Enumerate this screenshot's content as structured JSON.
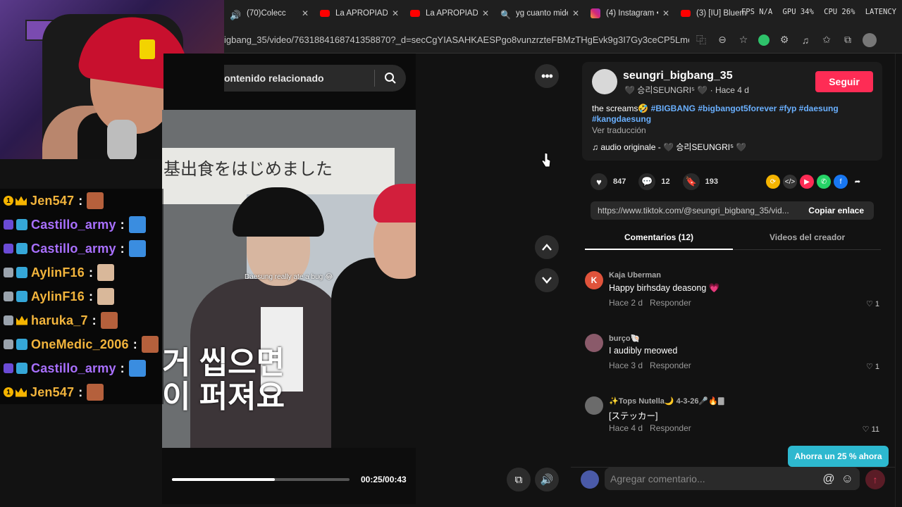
{
  "browser": {
    "tabs": [
      {
        "title": "(70)Colecc",
        "icon": "speaker-icon"
      },
      {
        "title": "La APROPIADA",
        "icon": "youtube-icon"
      },
      {
        "title": "La APROPIADA",
        "icon": "youtube-icon"
      },
      {
        "title": "yg cuanto mide",
        "icon": "search-icon"
      },
      {
        "title": "(4) Instagram •",
        "icon": "instagram-icon"
      },
      {
        "title": "(3) [IU] Bluemin",
        "icon": "youtube-icon"
      }
    ],
    "url": "igbang_35/video/7631884168741358870?_d=secCgYIASAHKAESPgo8vunzrzteFBMzTHgEvk9g3I7Gy3ceCP5Lmen...",
    "perf": {
      "fps": "FPS N/A",
      "gpu": "GPU 34%",
      "cpu": "CPU 26%",
      "lat": "LATENCY"
    }
  },
  "chat": [
    {
      "user": "Jen547",
      "color": "#f2b43c",
      "badges": [
        "1",
        "crown"
      ],
      "emote": "#b5603c"
    },
    {
      "user": "Castillo_army",
      "color": "#a970ff",
      "badges": [
        "sub",
        "gift"
      ],
      "emote": "#3a8de0"
    },
    {
      "user": "Castillo_army",
      "color": "#a970ff",
      "badges": [
        "sub",
        "gift"
      ],
      "emote": "#3a8de0"
    },
    {
      "user": "AylinF16",
      "color": "#f2b43c",
      "badges": [
        "shield",
        "gift"
      ],
      "emote": "#d9b89a"
    },
    {
      "user": "AylinF16",
      "color": "#f2b43c",
      "badges": [
        "shield",
        "gift"
      ],
      "emote": "#d9b89a"
    },
    {
      "user": "haruka_7",
      "color": "#f2b43c",
      "badges": [
        "shield",
        "crown"
      ],
      "emote": "#b5603c"
    },
    {
      "user": "OneMedic_2006",
      "color": "#f2b43c",
      "badges": [
        "shield",
        "gift"
      ],
      "emote": "#b5603c"
    },
    {
      "user": "Castillo_army",
      "color": "#a970ff",
      "badges": [
        "sub",
        "gift"
      ],
      "emote": "#3a8de0"
    },
    {
      "user": "Jen547",
      "color": "#f2b43c",
      "badges": [
        "1",
        "crown"
      ],
      "emote": "#b5603c"
    }
  ],
  "search": {
    "text": "ontenido relacionado"
  },
  "video": {
    "sign_text": "基出食をはじめました",
    "caption": "Daesung really ate a bug 😂",
    "subtitle_line1": "거 씹으면",
    "subtitle_line2": "이 퍼져요",
    "progress": 0.58,
    "time": "00:25/00:43"
  },
  "post": {
    "username": "seungri_bigbang_35",
    "subline": "🖤 승리SEUNGRI⁵ 🖤 · Hace 4 d",
    "follow_label": "Seguir",
    "desc_plain": "the screams🤣 ",
    "desc_tags_line1": "#BIGBANG #bigbangot5forever #fyp #daesung",
    "desc_tags_line2": "#kangdaesung",
    "translate_label": "Ver traducción",
    "music": "♫  audio originale - 🖤 승리SEUNGRI⁵ 🖤",
    "likes": "847",
    "comments": "12",
    "saves": "193",
    "link": "https://www.tiktok.com/@seungri_bigbang_35/vid...",
    "copy_label": "Copiar enlace"
  },
  "tabs": {
    "comments": "Comentarios (12)",
    "creator": "Videos del creador"
  },
  "comments": [
    {
      "user": "Kaja Uberman",
      "initial": "K",
      "avatar": "#e0533b",
      "text": "Happy birhsday deasong 💗",
      "time": "Hace 2 d",
      "reply": "Responder",
      "likes": "1"
    },
    {
      "user": "burço🐚",
      "initial": "",
      "avatar": "#8a5a6a",
      "text": "I audibly meowed",
      "time": "Hace 3 d",
      "reply": "Responder",
      "likes": "1"
    },
    {
      "user": "✨Tops Nutella🌙 4-3-26🎤🔥🀫",
      "initial": "",
      "avatar": "#6b6b6b",
      "text": "[ステッカー]",
      "time": "Hace 4 d",
      "reply": "Responder",
      "likes": "11"
    }
  ],
  "promo_label": "Ahorra un 25 % ahora",
  "comment_input": {
    "placeholder": "Agregar comentario..."
  }
}
